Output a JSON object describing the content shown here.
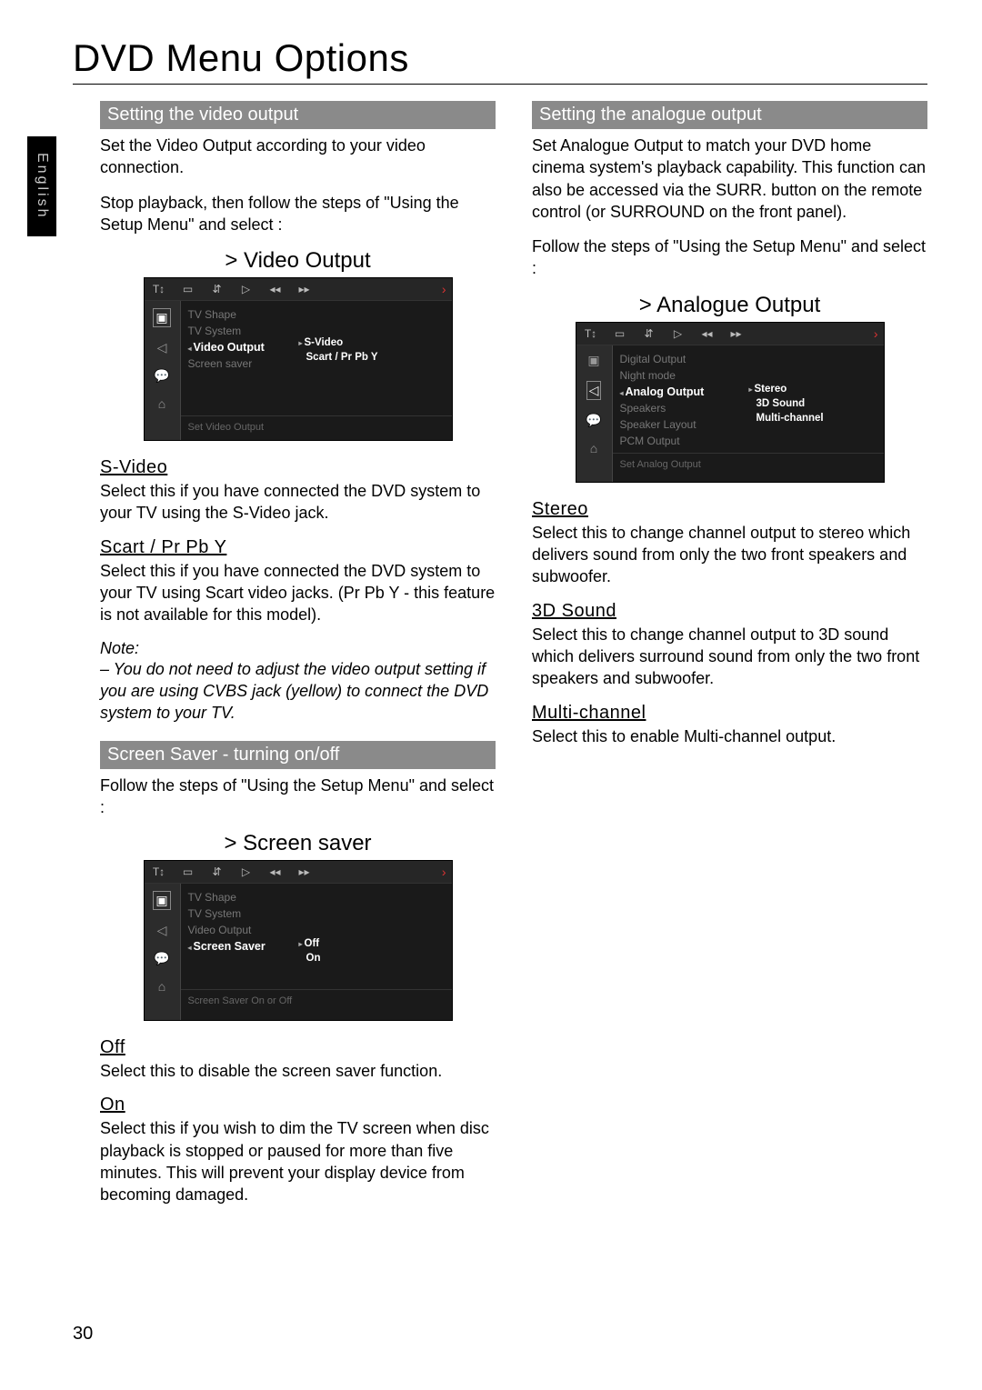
{
  "page": {
    "title": "DVD Menu Options",
    "language_tab": "English",
    "number": "30"
  },
  "left": {
    "sec1": {
      "heading": "Setting the video output",
      "p1": "Set the Video Output according to your video connection.",
      "p2": "Stop playback, then follow the steps of \"Using the Setup Menu\" and select :",
      "osd_title": ">  Video Output",
      "osd": {
        "items": [
          "TV Shape",
          "TV System",
          "Video Output",
          "Screen saver"
        ],
        "selected_index": 2,
        "options": [
          "S-Video",
          "Scart / Pr Pb Y"
        ],
        "footer": "Set Video Output"
      },
      "svideo_h": "S-Video",
      "svideo_p": "Select this if you have connected the DVD system to your TV using the S-Video jack.",
      "scart_h": "Scart / Pr Pb  Y",
      "scart_p": "Select this if you have connected the DVD system to your TV using Scart video jacks. (Pr Pb Y - this feature is not available for this model).",
      "note_label": "Note:",
      "note_text": "–  You do not need to adjust the video output setting if you are using CVBS jack (yellow) to connect the DVD system to your TV."
    },
    "sec2": {
      "heading": "Screen Saver - turning on/off",
      "p1": "Follow the steps of \"Using the Setup Menu\" and select :",
      "osd_title": ">  Screen saver",
      "osd": {
        "items": [
          "TV Shape",
          "TV System",
          "Video Output",
          "Screen Saver"
        ],
        "selected_index": 3,
        "options": [
          "Off",
          "On"
        ],
        "footer": "Screen Saver On or Off"
      },
      "off_h": "Off",
      "off_p": "Select this to disable the screen saver function.",
      "on_h": "On",
      "on_p": "Select this if you wish to dim the TV screen when disc playback is stopped or paused for more than five minutes.  This will prevent your display device from becoming damaged."
    }
  },
  "right": {
    "sec1": {
      "heading": "Setting the analogue output",
      "p1": "Set Analogue Output to match your DVD home cinema system's playback capability.  This function can also be accessed via the SURR. button on the remote control (or SURROUND on the front panel).",
      "p2": "Follow the steps of \"Using the Setup Menu\" and select :",
      "osd_title": ">  Analogue Output",
      "osd": {
        "items": [
          "Digital Output",
          "Night mode",
          "Analog Output",
          "Speakers",
          "Speaker Layout",
          "PCM Output"
        ],
        "selected_index": 2,
        "options": [
          "Stereo",
          "3D Sound",
          "Multi-channel"
        ],
        "footer": "Set Analog Output"
      },
      "stereo_h": "Stereo",
      "stereo_p": "Select this to change channel output to stereo which delivers sound from only the two front speakers and subwoofer.",
      "threeD_h": "3D Sound",
      "threeD_p": "Select this to change channel output to 3D sound which delivers surround sound from only the two front speakers and subwoofer.",
      "multi_h": "Multi-channel",
      "multi_p": "Select this to enable Multi-channel output."
    }
  },
  "icons": {
    "top": [
      "T↕",
      "▭",
      "⇵",
      "▷",
      "◂◂",
      "▸▸"
    ],
    "side": [
      "▣",
      "◁",
      "💬",
      "⌂"
    ]
  }
}
